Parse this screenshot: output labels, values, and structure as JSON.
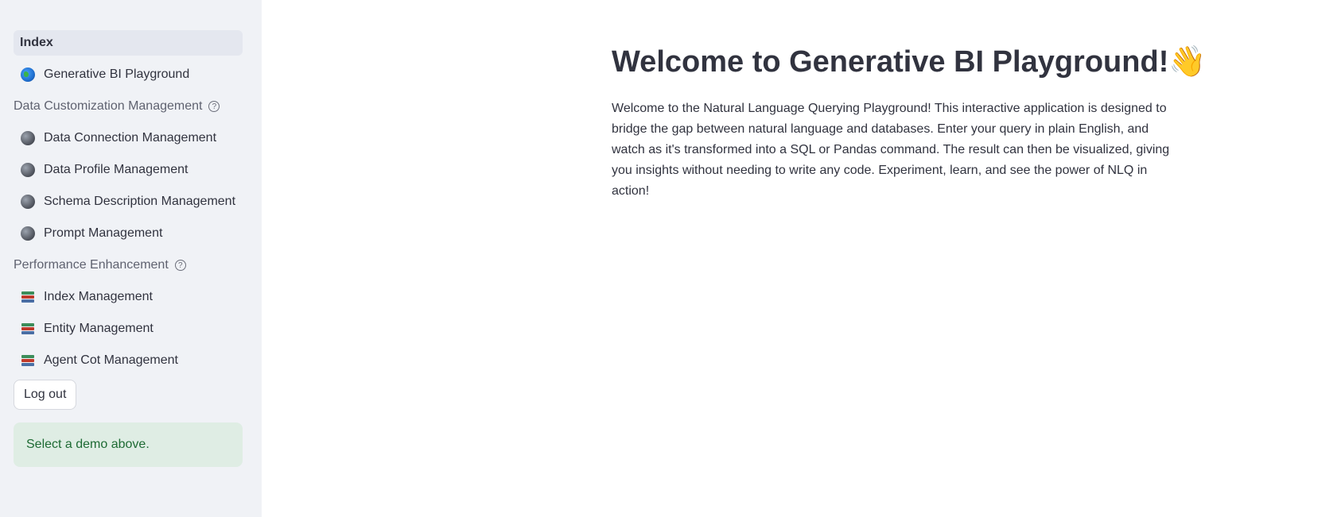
{
  "sidebar": {
    "items_top": [
      {
        "label": "Index",
        "icon": "none",
        "active": true
      },
      {
        "label": "Generative BI Playground",
        "icon": "globe-earth-icon"
      }
    ],
    "sections": [
      {
        "title": "Data Customization Management",
        "help_icon": "help-circle-icon",
        "items": [
          {
            "label": "Data Connection Management",
            "icon": "globe-dark-icon"
          },
          {
            "label": "Data Profile Management",
            "icon": "globe-dark-icon"
          },
          {
            "label": "Schema Description Management",
            "icon": "globe-dark-icon"
          },
          {
            "label": "Prompt Management",
            "icon": "globe-dark-icon"
          }
        ]
      },
      {
        "title": "Performance Enhancement",
        "help_icon": "help-circle-icon",
        "items": [
          {
            "label": "Index Management",
            "icon": "books-icon"
          },
          {
            "label": "Entity Management",
            "icon": "books-icon"
          },
          {
            "label": "Agent Cot Management",
            "icon": "books-icon"
          }
        ]
      }
    ],
    "logout_label": "Log out",
    "alert_text": "Select a demo above.",
    "help_glyph": "?"
  },
  "main": {
    "title": "Welcome to Generative BI Playground!👋",
    "description": "Welcome to the Natural Language Querying Playground! This interactive application is designed to bridge the gap between natural language and databases. Enter your query in plain English, and watch as it's transformed into a SQL or Pandas command. The result can then be visualized, giving you insights without needing to write any code. Experiment, learn, and see the power of NLQ in action!"
  },
  "colors": {
    "sidebar_bg": "#f0f2f6",
    "active_item_bg": "#e4e7ef",
    "alert_bg": "#dfede4",
    "alert_text": "#1e6b34",
    "text": "#31333f"
  }
}
